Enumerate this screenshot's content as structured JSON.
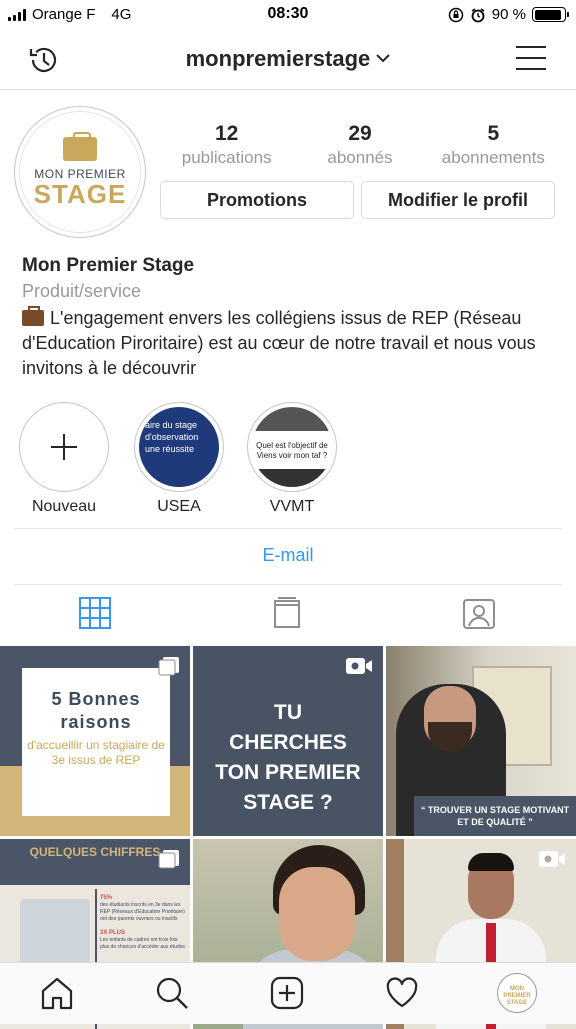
{
  "status": {
    "carrier": "Orange F",
    "network": "4G",
    "time": "08:30",
    "battery": "90 %",
    "battery_level": 0.9
  },
  "header": {
    "username": "monpremierstage"
  },
  "profile": {
    "avatar_line1": "MON PREMIER",
    "avatar_line2": "STAGE",
    "stats": [
      {
        "value": "12",
        "label": "publications"
      },
      {
        "value": "29",
        "label": "abonnés"
      },
      {
        "value": "5",
        "label": "abonnements"
      }
    ],
    "promotions_label": "Promotions",
    "edit_profile_label": "Modifier le profil",
    "name": "Mon Premier Stage",
    "category": "Produit/service",
    "bio": "L'engagement envers les collégiens issus de REP (Réseau d'Education Piroritaire) est au cœur de notre travail et nous vous invitons à le découvrir"
  },
  "highlights": [
    {
      "label": "Nouveau"
    },
    {
      "label": "USEA",
      "cover_text": "aire du stage d'observation une réussite"
    },
    {
      "label": "VVMT",
      "cover_text": "Quel est l'objectif de Viens voir mon taf ?"
    }
  ],
  "contact": {
    "email_label": "E-mail"
  },
  "tabs": [
    "grid-icon",
    "igtv-icon",
    "tagged-icon"
  ],
  "posts": [
    {
      "title": "5 Bonnes raisons",
      "subtitle": "d'accueillir un stagiaire de 3e issus de REP",
      "badge": "carousel-icon"
    },
    {
      "text": "TU CHERCHES TON PREMIER STAGE ?",
      "badge": "video-icon"
    },
    {
      "caption": "“ TROUVER UN STAGE MOTIVANT ET DE QUALITÉ ”"
    },
    {
      "title": "QUELQUES CHIFFRES",
      "stat1": "75%",
      "stat1_text": "des étudiants inscrits en 3e dans les REP (Réseaux d'Education Prioritaire) ont des parents ouvriers ou inactifs",
      "stat2": "3X PLUS",
      "stat2_text": "Les enfants de cadres ont trois fois plus de chances d'accéder aux études",
      "badge": "carousel-icon"
    },
    {},
    {
      "badge": "video-icon"
    }
  ],
  "bottom_nav": [
    "home-icon",
    "search-icon",
    "add-icon",
    "heart-icon",
    "profile-icon"
  ],
  "bottom_avatar": "MON PREMIER STAGE"
}
